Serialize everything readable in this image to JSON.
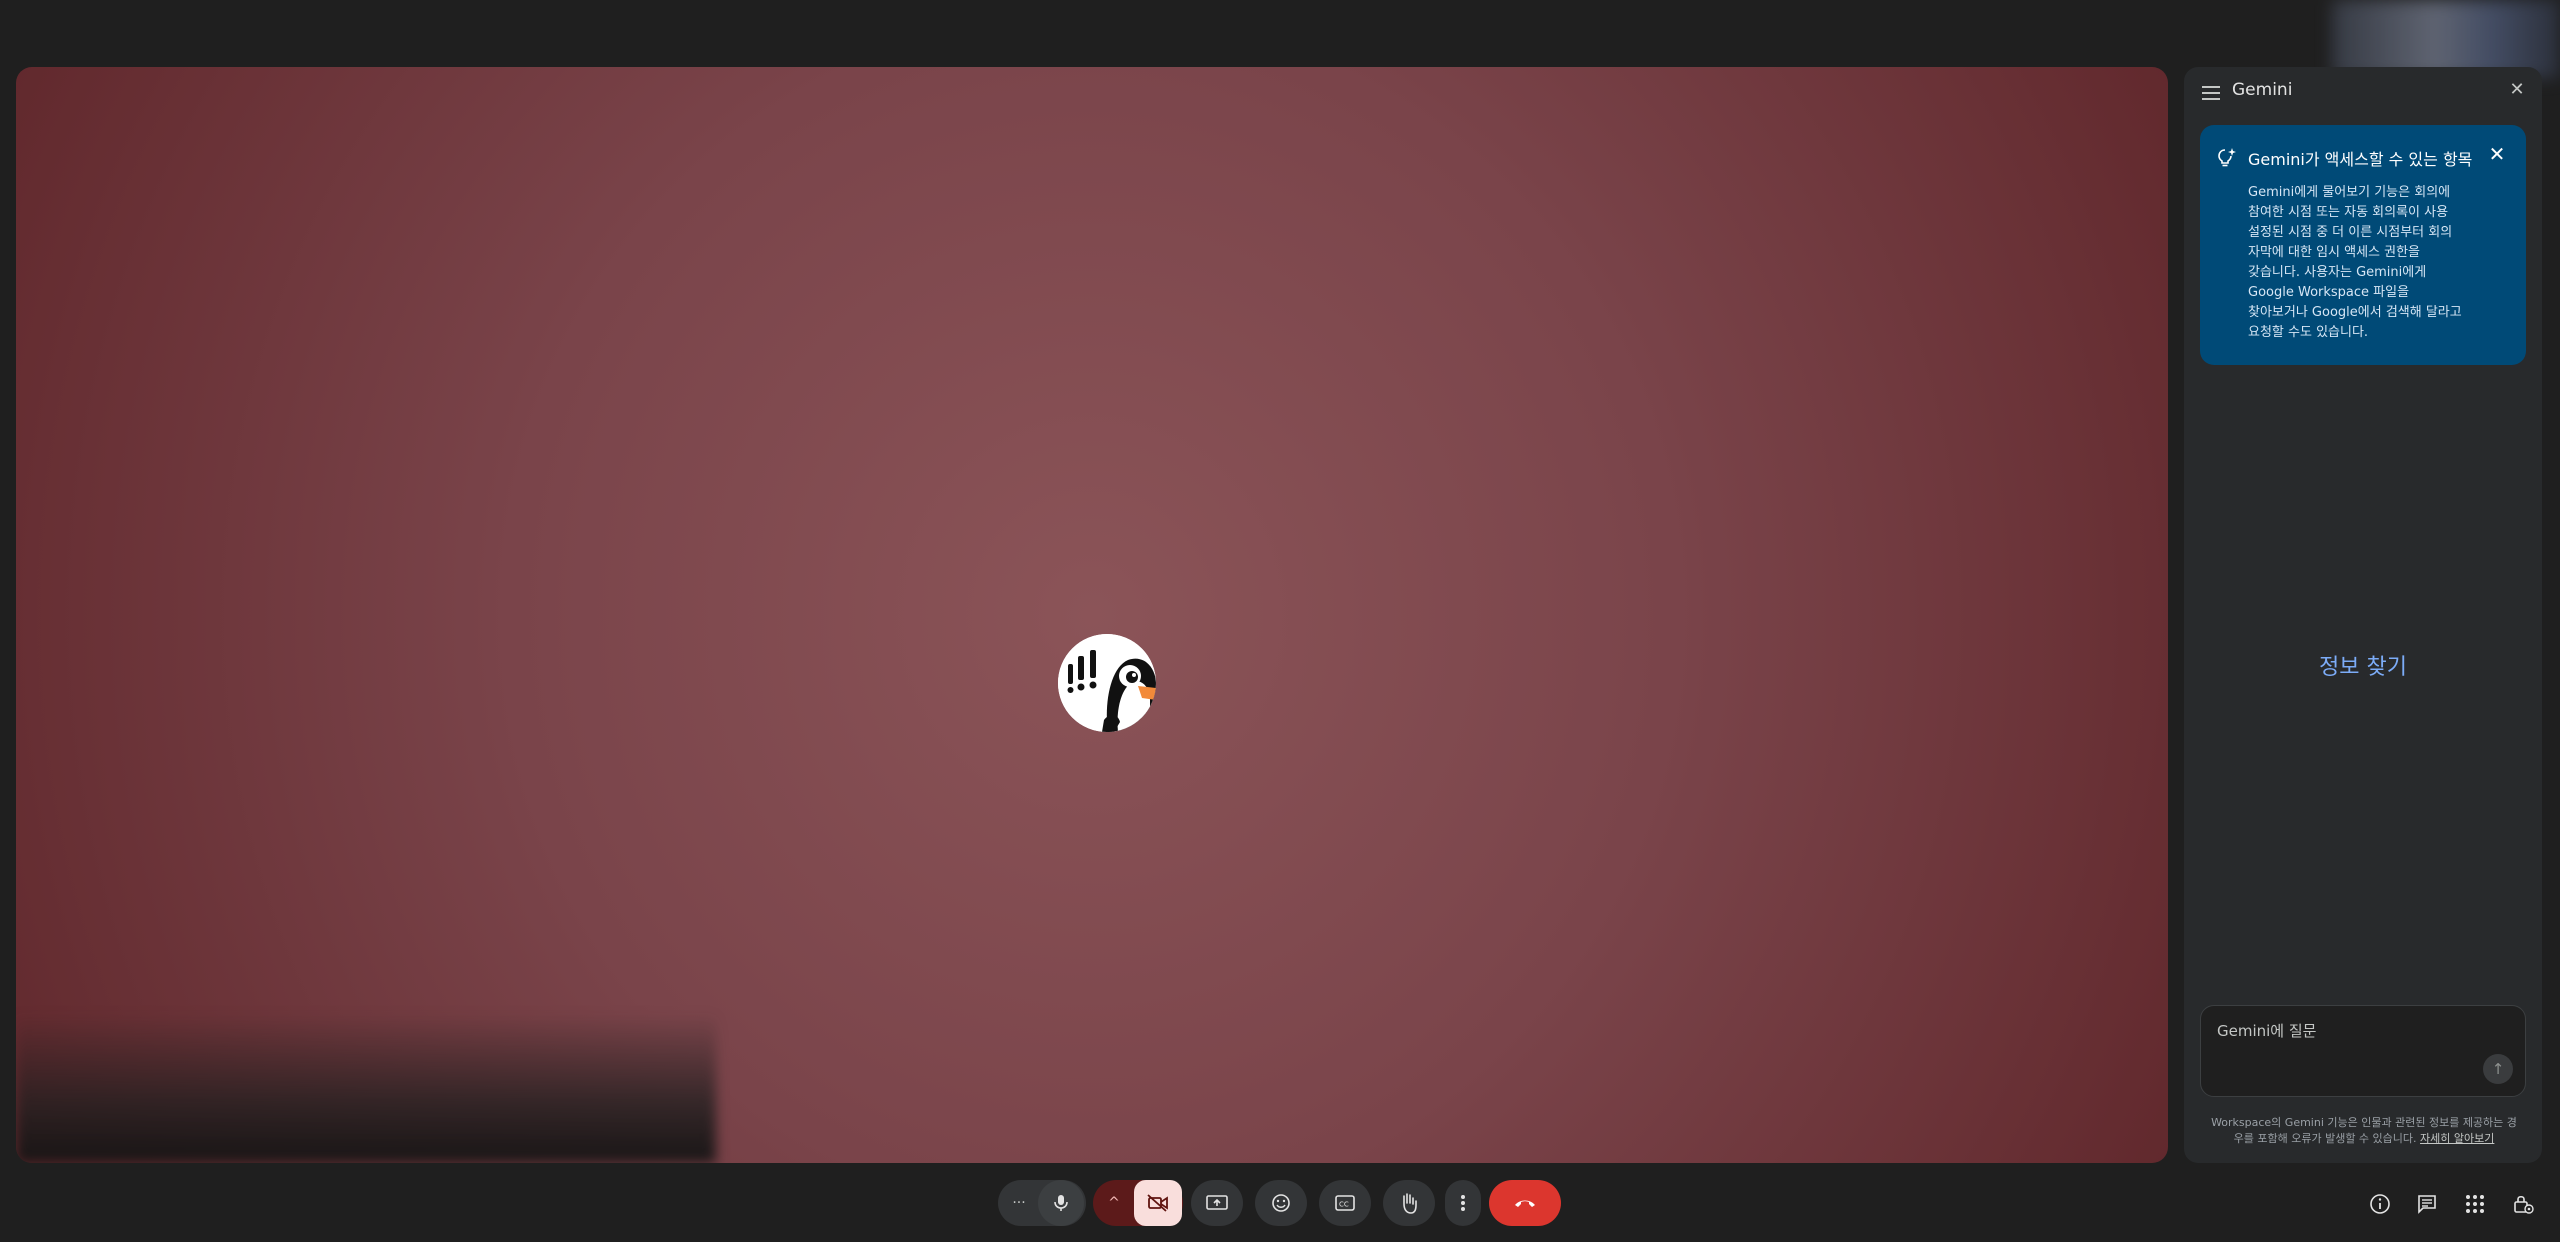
{
  "gemini_panel": {
    "title": "Gemini",
    "info_card": {
      "title": "Gemini가 액세스할 수 있는 항목",
      "body": "Gemini에게 물어보기 기능은 회의에 참여한 시점 또는 자동 회의록이 사용 설정된 시점 중 더 이른 시점부터 회의 자막에 대한 임시 액세스 권한을 갖습니다. 사용자는 Gemini에게 Google Workspace 파일을 찾아보거나 Google에서 검색해 달라고 요청할 수도 있습니다."
    },
    "prompt_suggestion": "정보 찾기",
    "input": {
      "placeholder": "Gemini에 질문"
    },
    "disclaimer": {
      "text": "Workspace의 Gemini 기능은 인물과 관련된 정보를 제공하는 경우를 포함해 오류가 발생할 수 있습니다.",
      "link": "자세히 알아보기"
    }
  },
  "controls": {
    "more_label": "···",
    "icons": [
      "more-icon",
      "microphone-icon",
      "chevron-up-icon",
      "camera-off-icon",
      "present-screen-icon",
      "emoji-icon",
      "captions-icon",
      "raise-hand-icon",
      "more-options-icon",
      "end-call-icon"
    ],
    "right_icons": [
      "info-icon",
      "chat-icon",
      "apps-icon",
      "host-controls-icon"
    ]
  },
  "colors": {
    "stage_center": "#8b5458",
    "stage_edge": "#5e2529",
    "card_bg": "#004a77",
    "end_call": "#dc362e",
    "camera_off_bg": "#f9dedc",
    "link_blue": "#7cacf8"
  }
}
